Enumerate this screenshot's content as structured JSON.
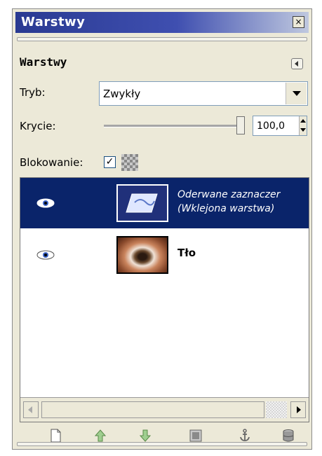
{
  "window": {
    "title": "Warstwy",
    "close_label": "×"
  },
  "panel": {
    "heading": "Warstwy"
  },
  "mode": {
    "label": "Tryb:",
    "value": "Zwykły"
  },
  "opacity": {
    "label": "Krycie:",
    "value": "100,0",
    "level_percent": 100
  },
  "lock": {
    "label": "Blokowanie:",
    "checked": true
  },
  "layers": [
    {
      "name_line1": "Oderwane zaznaczer",
      "name_line2": "(Wklejona warstwa)",
      "selected": true,
      "visible": true
    },
    {
      "name_line1": "Tło",
      "selected": false,
      "visible": true
    }
  ],
  "toolbar_icons": [
    "new-layer-icon",
    "raise-layer-icon",
    "lower-layer-icon",
    "duplicate-layer-icon",
    "anchor-layer-icon",
    "delete-layer-icon"
  ],
  "colors": {
    "titlebar_start": "#2a3a92",
    "selection": "#0a246a",
    "window_bg": "#ece9d8"
  }
}
